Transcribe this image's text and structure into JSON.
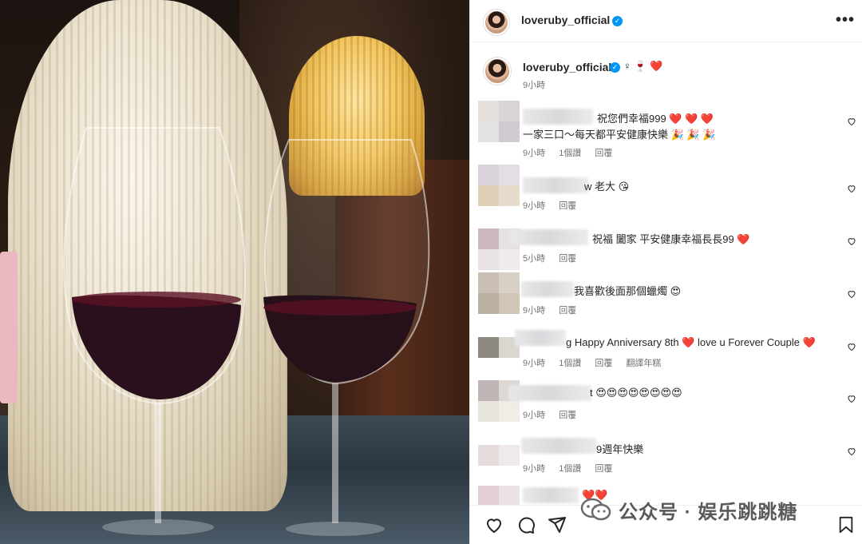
{
  "post": {
    "username": "loveruby_official",
    "more_label": "•••",
    "caption_emoji": "♀ 🍷 ❤️",
    "caption_time": "9小時"
  },
  "comments": [
    {
      "lines": [
        "祝您們幸福999 ❤️ ❤️ ❤️",
        "一家三口～每天都平安健康快樂 🎉 🎉 🎉"
      ],
      "time": "9小時",
      "likes": "1個讚",
      "reply": "回覆",
      "translate": ""
    },
    {
      "lines": [
        "w 老大 😘"
      ],
      "time": "9小時",
      "likes": "",
      "reply": "回覆",
      "translate": ""
    },
    {
      "lines": [
        "祝福 闔家 平安健康幸福長長99 ❤️"
      ],
      "time": "5小時",
      "likes": "",
      "reply": "回覆",
      "translate": ""
    },
    {
      "lines": [
        "我喜歡後面那個蠟燭 😍"
      ],
      "time": "9小時",
      "likes": "",
      "reply": "回覆",
      "translate": ""
    },
    {
      "lines": [
        "g Happy Anniversary 8th ❤️ love u Forever Couple ❤️"
      ],
      "time": "9小時",
      "likes": "1個讚",
      "reply": "回覆",
      "translate": "翻譯年糕"
    },
    {
      "lines": [
        "t 😍😍😍😍😍😍😍😍"
      ],
      "time": "9小時",
      "likes": "",
      "reply": "回覆",
      "translate": ""
    },
    {
      "lines": [
        "9週年快樂"
      ],
      "time": "9小時",
      "likes": "1個讚",
      "reply": "回覆",
      "translate": ""
    },
    {
      "lines": [
        "❤️❤️"
      ],
      "time": "",
      "likes": "",
      "reply": "",
      "translate": ""
    }
  ],
  "watermark": {
    "text": "公众号 · 娱乐跳跳糖"
  },
  "icons": [
    "more-icon",
    "verified-icon",
    "heart-icon",
    "like-icon",
    "comment-icon",
    "share-icon",
    "bookmark-icon",
    "wechat-icon"
  ]
}
